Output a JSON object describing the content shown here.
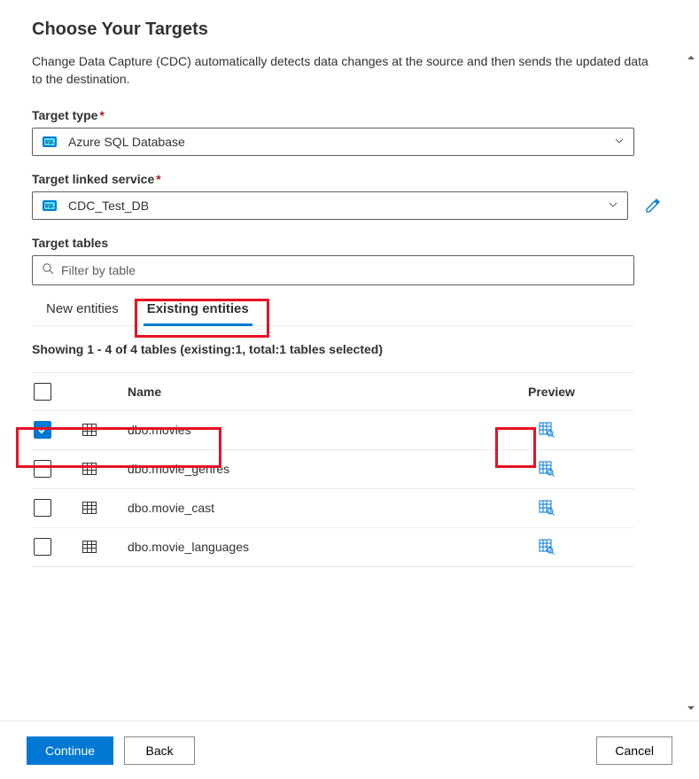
{
  "header": {
    "title": "Choose Your Targets",
    "description": "Change Data Capture (CDC) automatically detects data changes at the source and then sends the updated data to the destination."
  },
  "fields": {
    "target_type": {
      "label": "Target type",
      "required_marker": "*",
      "value": "Azure SQL Database"
    },
    "linked_service": {
      "label": "Target linked service",
      "required_marker": "*",
      "value": "CDC_Test_DB"
    },
    "tables": {
      "label": "Target tables",
      "filter_placeholder": "Filter by table"
    }
  },
  "tabs": {
    "new": "New entities",
    "existing": "Existing entities"
  },
  "summary": "Showing 1 - 4 of 4 tables (existing:1, total:1 tables selected)",
  "columns": {
    "name": "Name",
    "preview": "Preview"
  },
  "rows": [
    {
      "name": "dbo.movies",
      "checked": true
    },
    {
      "name": "dbo.movie_genres",
      "checked": false
    },
    {
      "name": "dbo.movie_cast",
      "checked": false
    },
    {
      "name": "dbo.movie_languages",
      "checked": false
    }
  ],
  "footer": {
    "continue": "Continue",
    "back": "Back",
    "cancel": "Cancel"
  }
}
